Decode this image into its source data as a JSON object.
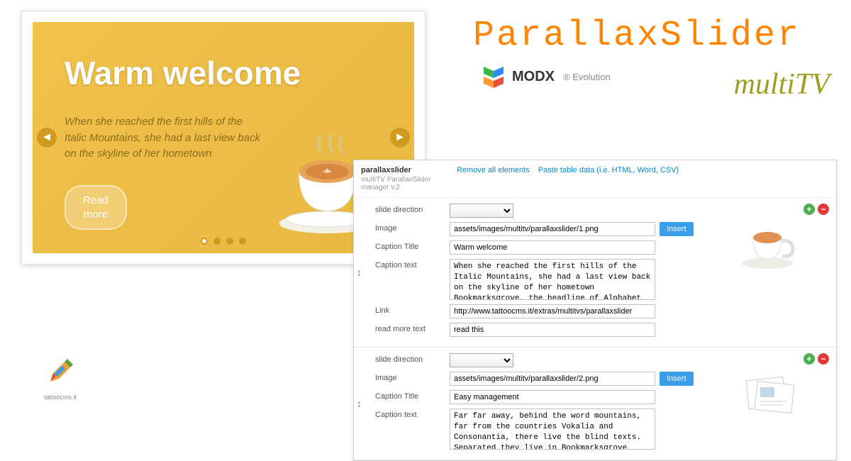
{
  "brand": {
    "title": "ParallaxSlider",
    "multitv": "multiTV"
  },
  "modx": {
    "name": "MODX",
    "suffix": "Evolution"
  },
  "slider": {
    "title": "Warm welcome",
    "text": "When she reached the first hills of the Italic Mountains, she had a last view back on the skyline of her hometown",
    "read_more": "Read\nmore"
  },
  "manager": {
    "title": "parallaxslider",
    "subtitle": "multiTV ParallaxSlider manager v.2",
    "remove_all": "Remove all elements",
    "paste_data": "Paste table data (i.e. HTML, Word, CSV)",
    "labels": {
      "slide_direction": "slide direction",
      "image": "Image",
      "caption_title": "Caption Title",
      "caption_text": "Caption text",
      "link": "Link",
      "read_more_text": "read more text"
    },
    "insert_label": "Insert",
    "records": [
      {
        "image": "assets/images/multitv/parallaxslider/1.png",
        "caption_title": "Warm welcome",
        "caption_text": "When she reached the first hills of the Italic Mountains, she had a last view back on the skyline of her hometown Bookmarksgrove, the headline of Alphabet Village and the subline of",
        "link": "http://www.tattoocms.it/extras/multitvs/parallaxslider",
        "read_more": "read this"
      },
      {
        "image": "assets/images/multitv/parallaxslider/2.png",
        "caption_title": "Easy management",
        "caption_text": "Far far away, behind the word mountains, far from the countries Vokalia and Consonantia, there live the blind texts. Separated they live in Bookmarksgrove right at the coast of the"
      }
    ]
  },
  "tattoo": {
    "label": "tattoocms.it"
  }
}
